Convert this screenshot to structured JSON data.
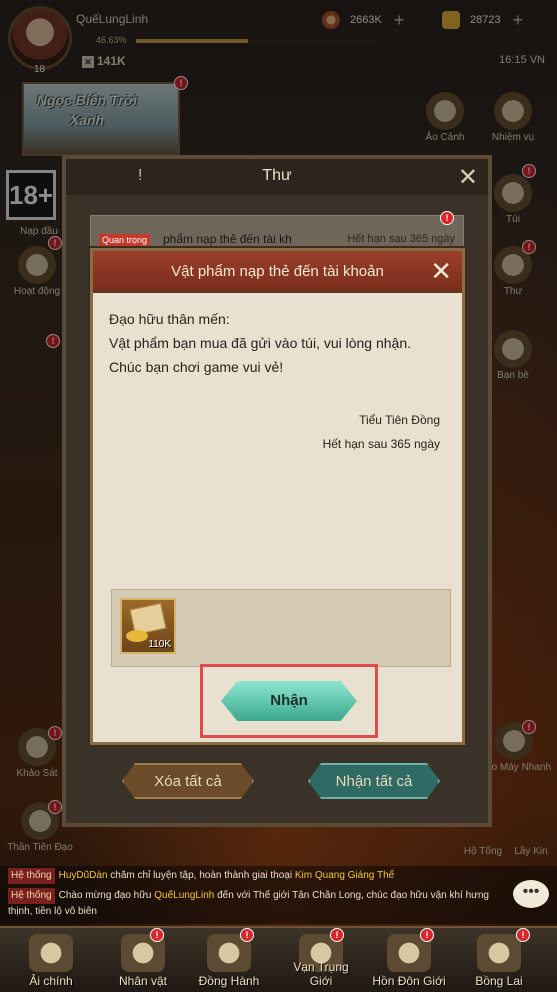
{
  "player": {
    "name": "QuếLungLinh",
    "level": "18",
    "exp_percent": "46.63%",
    "exp_fraction": 0.4663,
    "combat_power": "141K"
  },
  "currencies": {
    "coins": "2663K",
    "ingots": "28723"
  },
  "clock": "16:15 VN",
  "event_banner": "Ngọc Biển Trời Xanh",
  "age_rating": "18+",
  "side_left": [
    {
      "label": "Nạp đầu"
    },
    {
      "label": "Hoạt động"
    },
    {
      "label": "Khảo Sát"
    },
    {
      "label": "Thần Tiên Đạo"
    }
  ],
  "side_right": [
    {
      "label": "Ảo Cảnh"
    },
    {
      "label": "Nhiệm vụ"
    },
    {
      "label": "Túi"
    },
    {
      "label": "Thư"
    },
    {
      "label": "Bạn bè"
    },
    {
      "label": "Treo Máy Nhanh"
    },
    {
      "label": "Hộ Tống"
    },
    {
      "label": "Lầy Kin"
    }
  ],
  "mail_window": {
    "title": "Thư",
    "item": {
      "tag": "Quan trọng",
      "title": "phẩm nạp thẻ đến tài kh",
      "expiry": "Hết hạn sau 365 ngày"
    },
    "delete_all": "Xóa tất cả",
    "receive_all": "Nhận tất cả"
  },
  "dialog": {
    "title": "Vật phẩm nạp thẻ đến tài khoản",
    "greeting": "Đạo hữu thân mến:",
    "line1": "Vật phẩm bạn mua đã gửi vào túi, vui lòng nhận.",
    "line2": "Chúc bạn chơi game vui vẻ!",
    "sender": "Tiểu Tiên Đồng",
    "expiry": "Hết hạn sau 365 ngày",
    "reward_qty": "110K",
    "accept_label": "Nhận"
  },
  "chat": {
    "tag": "Hệ thống",
    "msg1_user": "HuyDũDàn",
    "msg1_text": " chăm chỉ luyện tập, hoàn thành giai thoại ",
    "msg1_hl": "Kim Quang Giáng Thế",
    "msg2_text1": "Chào mừng đạo hữu ",
    "msg2_user": "QuếLungLinh",
    "msg2_text2": " đến với Thế giới Tân Chân Long, chúc đạo hữu vận khí hưng thịnh, tiền lộ vô biên"
  },
  "bottom_nav": [
    {
      "label": "Ải chính"
    },
    {
      "label": "Nhân vật"
    },
    {
      "label": "Đồng Hành"
    },
    {
      "label": "Vạn Trụng Giới"
    },
    {
      "label": "Hồn Đôn Giới"
    },
    {
      "label": "Bồng Lai"
    }
  ],
  "colors": {
    "accent_red": "#d8262a",
    "highlight_box": "#e04b4b",
    "accept_green": "#3aa98e"
  }
}
